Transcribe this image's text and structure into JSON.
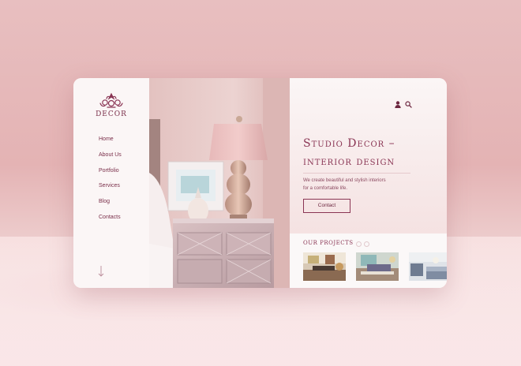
{
  "brand": {
    "name": "DECOR",
    "logo_icon": "ornament-crown-icon"
  },
  "nav": {
    "items": [
      {
        "label": "Home"
      },
      {
        "label": "About Us"
      },
      {
        "label": "Portfolio"
      },
      {
        "label": "Services"
      },
      {
        "label": "Blog"
      },
      {
        "label": "Contacts"
      }
    ],
    "scroll_icon": "arrow-down-icon"
  },
  "header": {
    "user_icon": "user-icon",
    "search_icon": "search-icon"
  },
  "hero": {
    "title_line1": "Studio Decor –",
    "title_line2": "interior design",
    "description_line1": "We create beautiful and stylish interiors",
    "description_line2": "for a comfortable life.",
    "cta_label": "Contact"
  },
  "projects": {
    "title": "OUR PROJECTS",
    "pager_icons": [
      "chevron-left-icon",
      "chevron-right-icon"
    ]
  },
  "colors": {
    "accent": "#8a3554",
    "background_pink": "#e6b9ba",
    "panel": "#fbf6f6"
  }
}
